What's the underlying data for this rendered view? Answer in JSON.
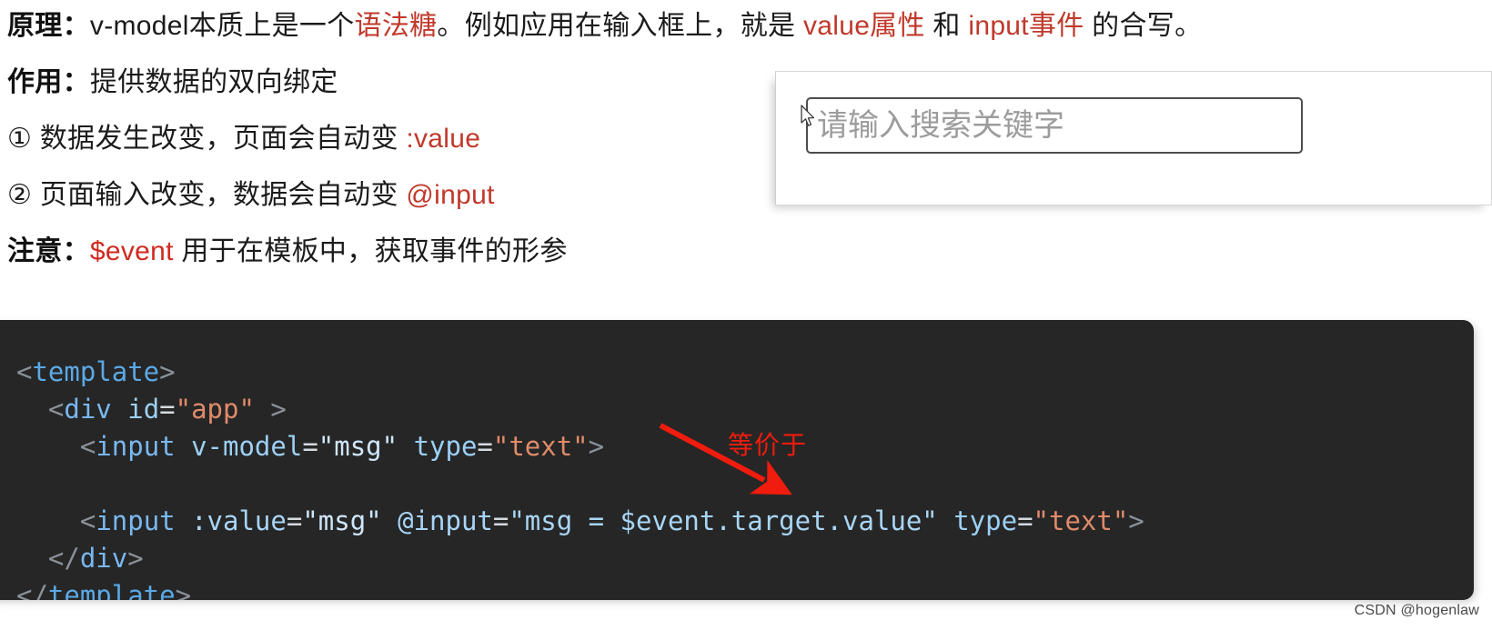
{
  "notes": {
    "line1": {
      "label": "原理：",
      "seg1": "v-model本质上是一个",
      "hl1": "语法糖",
      "seg2": "。例如应用在输入框上，就是 ",
      "hl2": "value属性",
      "seg3": " 和 ",
      "hl3": "input事件",
      "seg4": " 的合写。"
    },
    "line2": {
      "label": "作用：",
      "text": "提供数据的双向绑定"
    },
    "line3": {
      "marker": "①",
      "text": " 数据发生改变，页面会自动变 ",
      "hl": ":value"
    },
    "line4": {
      "marker": "②",
      "text": " 页面输入改变，数据会自动变 ",
      "hl": "@input"
    },
    "line5": {
      "label": "注意：",
      "hl": "$event",
      "text": " 用于在模板中，获取事件的形参"
    }
  },
  "demo": {
    "input_placeholder": "请输入搜索关键字",
    "input_value": "",
    "cursor_icon": "mouse-pointer-icon"
  },
  "code": {
    "language": "html",
    "lines": [
      {
        "indent": 0,
        "tokens": [
          {
            "t": "<",
            "c": "tok-punct"
          },
          {
            "t": "template",
            "c": "tok-tag"
          },
          {
            "t": ">",
            "c": "tok-punct"
          }
        ]
      },
      {
        "indent": 1,
        "tokens": [
          {
            "t": "<",
            "c": "tok-punct"
          },
          {
            "t": "div",
            "c": "tok-tag2"
          },
          {
            "t": " ",
            "c": "tok-eq"
          },
          {
            "t": "id",
            "c": "tok-attr"
          },
          {
            "t": "=",
            "c": "tok-eq"
          },
          {
            "t": "\"app\"",
            "c": "tok-str"
          },
          {
            "t": " ",
            "c": "tok-eq"
          },
          {
            "t": ">",
            "c": "tok-punct"
          }
        ]
      },
      {
        "indent": 2,
        "tokens": [
          {
            "t": "<",
            "c": "tok-punct"
          },
          {
            "t": "input",
            "c": "tok-tag2"
          },
          {
            "t": " ",
            "c": "tok-eq"
          },
          {
            "t": "v-model",
            "c": "tok-attr"
          },
          {
            "t": "=",
            "c": "tok-eq"
          },
          {
            "t": "\"msg\"",
            "c": "tok-strv"
          },
          {
            "t": " ",
            "c": "tok-eq"
          },
          {
            "t": "type",
            "c": "tok-attr"
          },
          {
            "t": "=",
            "c": "tok-eq"
          },
          {
            "t": "\"text\"",
            "c": "tok-str"
          },
          {
            "t": ">",
            "c": "tok-punct"
          }
        ]
      },
      {
        "indent": 0,
        "tokens": []
      },
      {
        "indent": 2,
        "tokens": [
          {
            "t": "<",
            "c": "tok-punct"
          },
          {
            "t": "input",
            "c": "tok-tag2"
          },
          {
            "t": " ",
            "c": "tok-eq"
          },
          {
            "t": ":value",
            "c": "tok-attr2"
          },
          {
            "t": "=",
            "c": "tok-eq"
          },
          {
            "t": "\"msg\"",
            "c": "tok-strv"
          },
          {
            "t": " ",
            "c": "tok-eq"
          },
          {
            "t": "@input",
            "c": "tok-attr2"
          },
          {
            "t": "=",
            "c": "tok-eq"
          },
          {
            "t": "\"msg = $event.target.value\"",
            "c": "tok-expr"
          },
          {
            "t": " ",
            "c": "tok-eq"
          },
          {
            "t": "type",
            "c": "tok-attr"
          },
          {
            "t": "=",
            "c": "tok-eq"
          },
          {
            "t": "\"text\"",
            "c": "tok-str"
          },
          {
            "t": ">",
            "c": "tok-punct"
          }
        ]
      },
      {
        "indent": 1,
        "tokens": [
          {
            "t": "</",
            "c": "tok-punct"
          },
          {
            "t": "div",
            "c": "tok-tag2"
          },
          {
            "t": ">",
            "c": "tok-punct"
          }
        ]
      },
      {
        "indent": 0,
        "tokens": [
          {
            "t": "</",
            "c": "tok-punct"
          },
          {
            "t": "template",
            "c": "tok-tag"
          },
          {
            "t": ">",
            "c": "tok-punct"
          }
        ]
      }
    ]
  },
  "annotation": {
    "label": "等价于",
    "color": "#f01c0e",
    "icon": "red-arrow-icon"
  },
  "watermark": {
    "text": "CSDN @hogenlaw"
  },
  "colors": {
    "accent_red": "#c0392b",
    "annotation_red": "#f01c0e",
    "code_background": "#262626",
    "page_background": "#ffffff"
  }
}
